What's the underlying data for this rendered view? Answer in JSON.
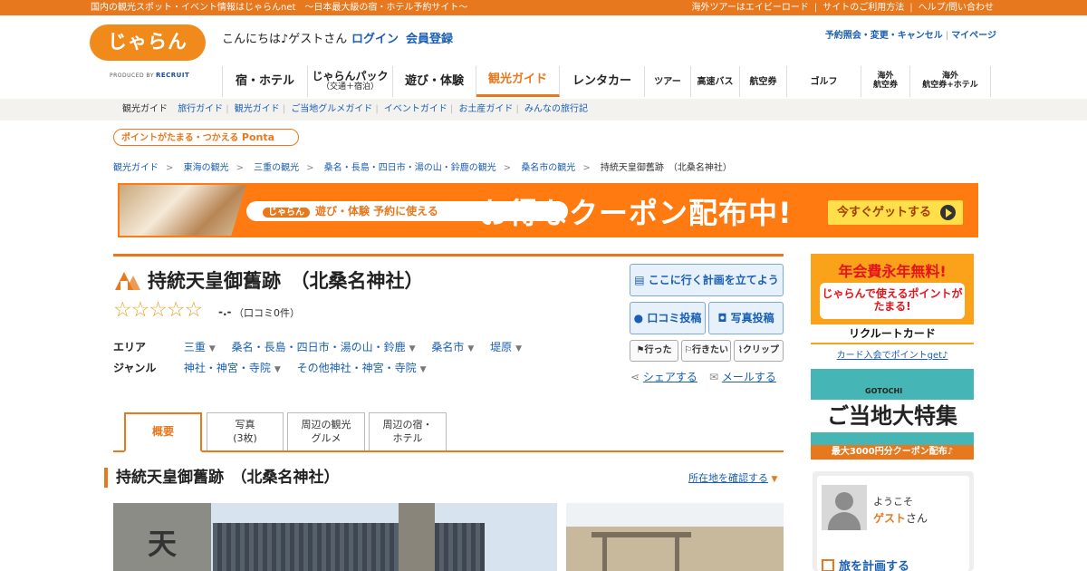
{
  "topbar": {
    "tagline": "国内の観光スポット・イベント情報はじゃらんnet　～日本最大級の宿・ホテル予約サイト～",
    "links": [
      "海外ツアーはエイビーロード",
      "サイトのご利用方法",
      "ヘルプ/問い合わせ"
    ]
  },
  "logo": {
    "text": "じゃらん",
    "produced_by": "PRODUCED BY",
    "brand": "RECRUIT"
  },
  "header": {
    "greeting": "こんにちは♪ゲストさん",
    "login": "ログイン",
    "register": "会員登録",
    "right_links": [
      "予約照会・変更・キャンセル",
      "マイページ"
    ]
  },
  "gnav": [
    {
      "label": "宿・ホテル",
      "sub": ""
    },
    {
      "label": "じゃらんパック",
      "sub": "（交通＋宿泊）"
    },
    {
      "label": "遊び・体験",
      "sub": ""
    },
    {
      "label": "観光ガイド",
      "sub": "",
      "active": true
    },
    {
      "label": "レンタカー",
      "sub": ""
    },
    {
      "label": "ツアー",
      "sub": ""
    },
    {
      "label": "高速バス",
      "sub": ""
    },
    {
      "label": "航空券",
      "sub": ""
    },
    {
      "label": "ゴルフ",
      "sub": ""
    },
    {
      "label": "海外",
      "sub": "航空券"
    },
    {
      "label": "海外",
      "sub": "航空券+ホテル"
    }
  ],
  "subnav": {
    "current": "観光ガイド",
    "items": [
      "旅行ガイド",
      "観光ガイド",
      "ご当地グルメガイド",
      "イベントガイド",
      "お土産ガイド",
      "みんなの旅行記"
    ]
  },
  "ponta": {
    "text": "ポイントがたまる・つかえる",
    "brand": "Ponta"
  },
  "breadcrumb": {
    "items": [
      "観光ガイド",
      "東海の観光",
      "三重の観光",
      "桑名・長島・四日市・湯の山・鈴鹿の観光",
      "桑名市の観光"
    ],
    "current": "持統天皇御舊跡　（北桑名神社）"
  },
  "banner": {
    "pill_brand": "じゃらん",
    "pill_text": "遊び・体験 予約に使える",
    "headline": "お得なクーポン配布中!",
    "cta": "今すぐゲットする"
  },
  "spot": {
    "title": "持統天皇御舊跡　（北桑名神社）",
    "stars": "☆☆☆☆☆",
    "score": "-.-",
    "reviews": "（口コミ0件）",
    "area_label": "エリア",
    "area": [
      "三重",
      "桑名・長島・四日市・湯の山・鈴鹿",
      "桑名市",
      "堤原"
    ],
    "genre_label": "ジャンル",
    "genre": [
      "神社・神宮・寺院",
      "その他神社・神宮・寺院"
    ]
  },
  "actions": {
    "plan": "ここに行く計画を立てよう",
    "review": "口コミ投稿",
    "photo": "写真投稿",
    "been": "行った",
    "want": "行きたい",
    "clip": "クリップ",
    "share": "シェアする",
    "mail": "メールする"
  },
  "tabs": [
    {
      "line1": "概要",
      "line2": ""
    },
    {
      "line1": "写真",
      "line2": "(3枚)"
    },
    {
      "line1": "周辺の観光",
      "line2": "グルメ"
    },
    {
      "line1": "周辺の宿・",
      "line2": "ホテル"
    }
  ],
  "section": {
    "title": "持統天皇御舊跡　（北桑名神社）",
    "map_link": "所在地を確認する"
  },
  "sidebar": {
    "card1": {
      "headline": "年会費永年無料!",
      "body": "じゃらんで使えるポイントがたまる!",
      "brand": "リクルートカード"
    },
    "card1_link": "カード入会でポイントget♪",
    "card2": {
      "label": "GOTOCHI",
      "title": "ご当地大特集",
      "footer": "最大3000円分クーポン配布♪"
    },
    "welcome": {
      "line1": "ようこそ",
      "guest": "ゲスト",
      "suffix": "さん",
      "plan": "旅を計画する"
    }
  },
  "colors": {
    "accent": "#e8781e",
    "link": "#1a5fb4",
    "star": "#e8a323"
  }
}
